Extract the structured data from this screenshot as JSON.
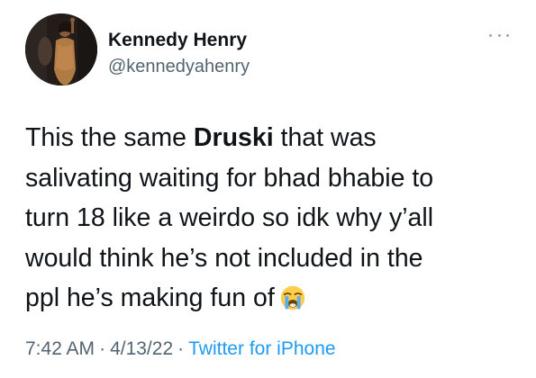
{
  "author": {
    "name": "Kennedy Henry",
    "handle": "@kennedyahenry"
  },
  "tweet": {
    "line1_before": "This the same ",
    "line1_bold": "Druski",
    "line1_after": " that was",
    "line2": "salivating waiting for bhad bhabie to",
    "line3": "turn 18 like a weirdo so idk why y’all",
    "line4": "would think he’s not included in the",
    "line5": "ppl he’s making fun of",
    "emoji": "loudly-crying-face"
  },
  "meta": {
    "time": "7:42 AM",
    "separator": "·",
    "date": "4/13/22",
    "source": "Twitter for iPhone"
  },
  "icons": {
    "more": "more-options-icon"
  },
  "colors": {
    "text": "#0f1419",
    "secondary": "#536471",
    "link": "#1d9bf0"
  }
}
